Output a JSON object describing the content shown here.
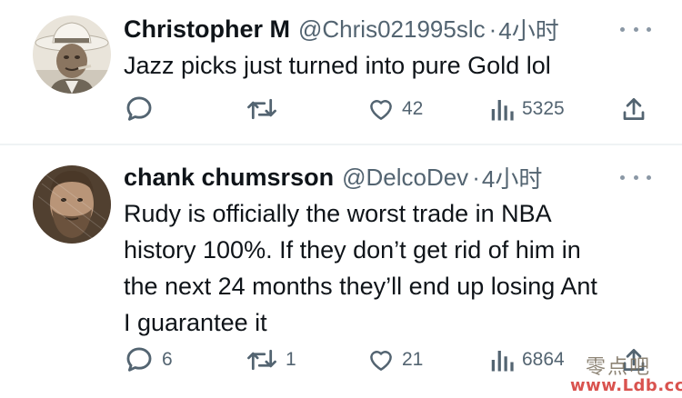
{
  "tweets": [
    {
      "display_name": "Christopher M",
      "handle": "@Chris021995slc",
      "separator": "·",
      "time": "4小时",
      "text": "Jazz picks just turned into pure Gold lol",
      "actions": {
        "reply_count": "",
        "retweet_count": "",
        "like_count": "42",
        "view_count": "5325"
      },
      "avatar_icon": "avatar-cowboy-hat-photo"
    },
    {
      "display_name": "chank chumsrson",
      "handle": "@DelcoDev",
      "separator": "·",
      "time": "4小时",
      "text": "Rudy is officially the worst trade in NBA\nhistory 100%. If they don’t get rid of him in\nthe next 24 months they’ll end up losing Ant\nI guarantee it",
      "actions": {
        "reply_count": "6",
        "retweet_count": "1",
        "like_count": "21",
        "view_count": "6864"
      },
      "avatar_icon": "avatar-bearded-man-photo"
    }
  ],
  "watermark": {
    "chinese": "零点吧",
    "url": "www.Ldb.cc"
  },
  "colors": {
    "text_primary": "#0f1419",
    "text_secondary": "#536471",
    "divider": "#eff3f4",
    "watermark_url": "#d9534f"
  }
}
